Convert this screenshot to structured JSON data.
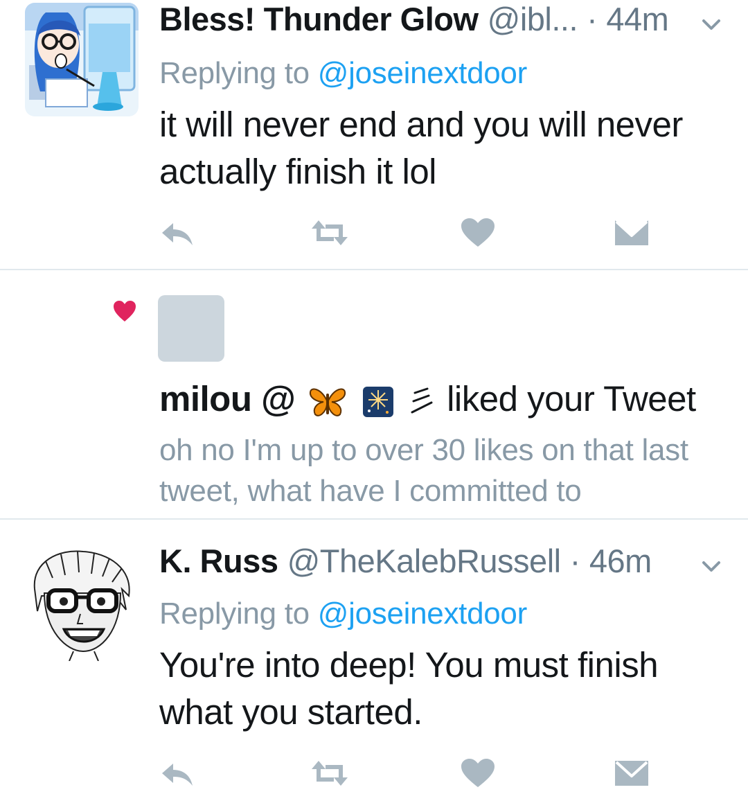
{
  "tweets": [
    {
      "display_name": "Bless! Thunder Glow",
      "handle": "@ibl...",
      "separator": "·",
      "time": "44m",
      "replying_prefix": "Replying to ",
      "replying_handle": "@joseinextdoor",
      "text": "it will never end and you will never actually finish it lol",
      "avatar_icon": "anime-girl-glasses-avatar"
    },
    {
      "display_name": "K. Russ",
      "handle": "@TheKalebRussell",
      "separator": "·",
      "time": "46m",
      "replying_prefix": "Replying to ",
      "replying_handle": "@joseinextdoor",
      "text": "You're into deep! You must finish what you started.",
      "avatar_icon": "manga-boy-glasses-avatar"
    }
  ],
  "notification": {
    "type_icon": "heart-icon",
    "user_name": "milou @",
    "emojis": [
      "butterfly-emoji",
      "fireworks-emoji",
      "three-lines-glyph"
    ],
    "action_text": "liked your Tweet",
    "snippet": "oh no I'm up to over 30 likes on that last tweet, what have I committed to"
  },
  "action_icons": [
    "reply-icon",
    "retweet-icon",
    "like-icon",
    "dm-icon"
  ],
  "colors": {
    "link_blue": "#1da1f2",
    "secondary_text": "#657786",
    "muted_text": "#8899a6",
    "action_icon_gray": "#aab8c2",
    "like_red": "#e0245e",
    "divider": "#e1e8ed",
    "placeholder_avatar": "#ccd6dd"
  }
}
